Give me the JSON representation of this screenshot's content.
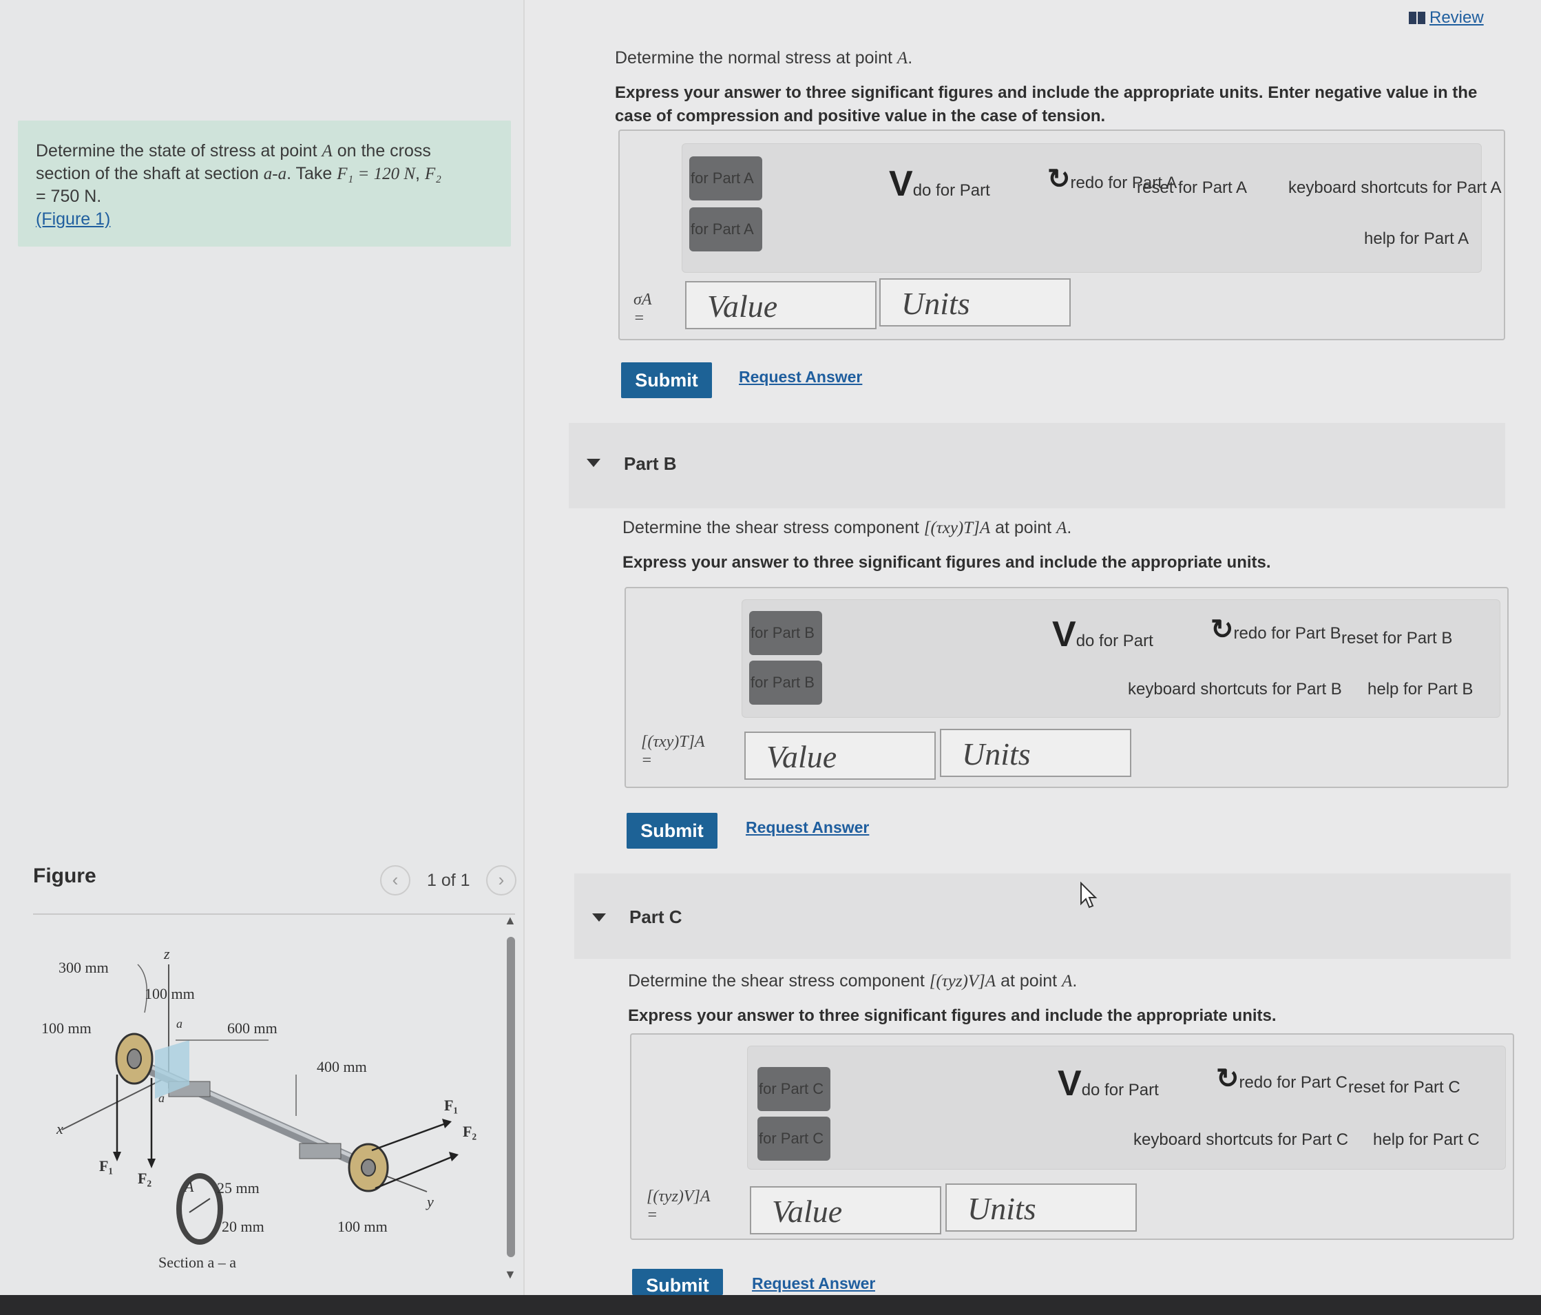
{
  "review": {
    "label": "Review"
  },
  "problem": {
    "line1": "Determine the state of stress at point ",
    "point": "A",
    "line1b": " on the cross",
    "line2": "section of the shaft at section ",
    "section": "a-a",
    "line2b": ". Take ",
    "f1": "F₁ = 120 N",
    "f2": "F₂",
    "line3": "= 750 N.",
    "figure_link": "(Figure 1)"
  },
  "figure": {
    "header": "Figure",
    "counter": "1 of 1",
    "labels": {
      "d300": "300 mm",
      "d100a": "100 mm",
      "d100b": "100 mm",
      "d600": "600 mm",
      "d400": "400 mm",
      "d25": "25 mm",
      "d20": "20 mm",
      "d100c": "100 mm",
      "z": "z",
      "x": "x",
      "y": "y",
      "y2": "y",
      "a1": "a",
      "a2": "a",
      "A": "A",
      "F1a": "F₁",
      "F2a": "F₂",
      "F1b": "F₁",
      "F2b": "F₂",
      "section": "Section a – a"
    }
  },
  "partA": {
    "question_prefix": "Determine the normal stress at point ",
    "question_point": "A",
    "question_suffix": ".",
    "instructions": "Express your answer to three significant figures and include the appropriate units. Enter negative value in the case of compression and positive value in the case of tension.",
    "tool1": "for Part A",
    "tool2": "for Part A",
    "undo": "do for Part",
    "redo": "redo for Part A",
    "reset": "reset for Part A",
    "shortcuts": "keyboard shortcuts for Part A",
    "help": "help for Part A",
    "var": "σA",
    "eq": "=",
    "value_placeholder": "Value",
    "units_placeholder": "Units",
    "submit": "Submit",
    "request": "Request Answer"
  },
  "partB": {
    "title": "Part B",
    "question_prefix": "Determine the shear stress component ",
    "question_expr": "[(τxy)T]A",
    "question_suffix": " at point ",
    "question_point": "A",
    "question_end": ".",
    "instructions": "Express your answer to three significant figures and include the appropriate units.",
    "tool1": "for Part B",
    "tool2": "for Part B",
    "undo": "do for Part",
    "redo": "redo for Part B",
    "reset": "reset for Part B",
    "shortcuts": "keyboard shortcuts for Part B",
    "help": "help for Part B",
    "var": "[(τxy)T]A",
    "eq": "=",
    "value_placeholder": "Value",
    "units_placeholder": "Units",
    "submit": "Submit",
    "request": "Request Answer"
  },
  "partC": {
    "title": "Part C",
    "question_prefix": "Determine the shear stress component ",
    "question_expr": "[(τyz)V]A",
    "question_suffix": " at point ",
    "question_point": "A",
    "question_end": ".",
    "instructions": "Express your answer to three significant figures and include the appropriate units.",
    "tool1": "for Part C",
    "tool2": "for Part C",
    "undo": "do for Part",
    "redo": "redo for Part C",
    "reset": "reset for Part C",
    "shortcuts": "keyboard shortcuts for Part C",
    "help": "help for Part C",
    "var": "[(τyz)V]A",
    "eq": "=",
    "value_placeholder": "Value",
    "units_placeholder": "Units",
    "submit": "Submit",
    "request": "Request Answer"
  },
  "colors": {
    "submit": "#1d6296",
    "link": "#1f5e9e",
    "problem_bg": "#cfe3da"
  }
}
